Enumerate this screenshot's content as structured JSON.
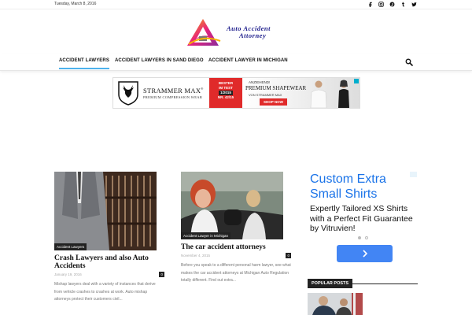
{
  "topbar": {
    "date": "Tuesday, March 8, 2016",
    "social_icons": [
      "facebook-icon",
      "instagram-icon",
      "pinterest-icon",
      "tumblr-icon",
      "twitter-icon"
    ]
  },
  "logo": {
    "line1": "Auto Accident",
    "line2": "Attorney"
  },
  "nav": {
    "items": [
      "Accident Lawyers",
      "Accident Lawyers in Sand Diego",
      "Accident Lawyer in Michigan"
    ],
    "search_icon": "search-icon"
  },
  "banner_ad": {
    "brand": "STRAMMER MAX",
    "registered": "®",
    "subline": "PREMIUM COMPRESSION WEAR",
    "badge_line1": "BESTER",
    "badge_line2": "IM TEST",
    "badge_num": "1/2015",
    "badge_line3": "NR. 42/15",
    "pre": "ANZIEHEND!",
    "main_line1": "PREMIUM SHAPEWEAR",
    "by": "VON STRAMMER MAX",
    "cta": "SHOP NOW"
  },
  "posts": [
    {
      "category": "Accident Lawyers",
      "title": "Crash Lawyers and also Auto Accidents",
      "date": "January 19, 2016",
      "comments": "0",
      "excerpt": "Mishap lawyers deal with a variety of instances that derive from vehicle crashes to crashes at work. Auto mishap attorneys protect their customers civil..."
    },
    {
      "category": "Accident Lawyer in Michigan",
      "title": "The car accident attorneys",
      "date": "November 4, 2015",
      "comments": "0",
      "excerpt": "Before you speak to a different personal harm lawyer, see what makes the car accident attorneys at Michigan Auto Regulation totally different. Find out extra..."
    }
  ],
  "side_ad": {
    "headline": "Custom Extra Small Shirts",
    "copy": "Expertly Tailored XS Shirts with a Perfect Fit Guarantee by Vitruvien!"
  },
  "popular": {
    "label": "Popular Posts"
  },
  "colors": {
    "accent": "#4db2ec",
    "ad_blue": "#1a73e8",
    "ad_button": "#4285f4",
    "badge_red": "#e02a2a",
    "logo_text": "#1a1a8a"
  }
}
